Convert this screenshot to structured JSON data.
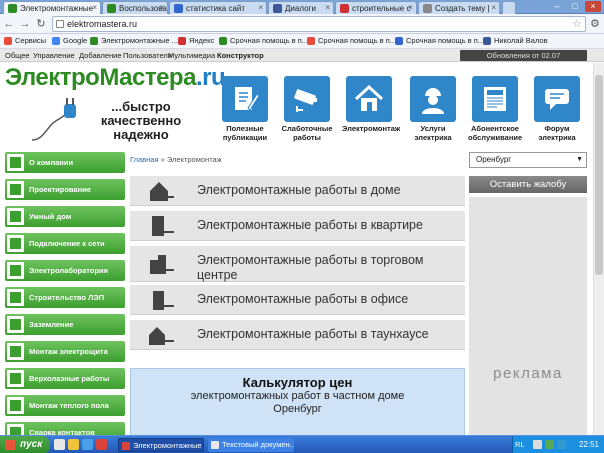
{
  "browser": {
    "tabs": [
      {
        "title": "Электромонтажные",
        "fav": "#2e8b24",
        "active": true
      },
      {
        "title": "Воспользовавшис",
        "fav": "#2e8b24",
        "active": false
      },
      {
        "title": "статистика сайт",
        "fav": "#3366cc",
        "active": false
      },
      {
        "title": "Диалоги",
        "fav": "#3b5998",
        "active": false
      },
      {
        "title": "строительные с",
        "fav": "#d03030",
        "active": false
      },
      {
        "title": "Создать тему |",
        "fav": "#888888",
        "active": false
      }
    ],
    "url": "elektromastera.ru",
    "bookmarks": [
      {
        "label": "Сервисы",
        "color": "#e84a3b"
      },
      {
        "label": "Google",
        "color": "#4285f4"
      },
      {
        "label": "Электромонтажные ...",
        "color": "#2e8b24"
      },
      {
        "label": "Яндекс",
        "color": "#d03030"
      },
      {
        "label": "Срочная помощь в п...",
        "color": "#2e8b24"
      },
      {
        "label": "Срочная помощь в п...",
        "color": "#e84a3b"
      },
      {
        "label": "Срочная помощь в п...",
        "color": "#3366cc"
      },
      {
        "label": "Николай Валов",
        "color": "#3b5998"
      }
    ]
  },
  "admin_menu": {
    "items": [
      "Общее",
      "Управление",
      "Добавление",
      "Пользователи",
      "Мультимедиа",
      "Конструктор"
    ],
    "updates": "Обновления от 02.07"
  },
  "header": {
    "logo_main": "ЭлектроМастера",
    "logo_domain": ".ru",
    "slogan": "...быстро качественно надежно",
    "nav": [
      {
        "label": "Полезные публикации",
        "icon": "document-pencil-icon"
      },
      {
        "label": "Слаботочные работы",
        "icon": "camera-icon"
      },
      {
        "label": "Электромонтаж",
        "icon": "house-icon"
      },
      {
        "label": "Услуги электрика",
        "icon": "worker-icon"
      },
      {
        "label": "Абонентское обслуживание",
        "icon": "newspaper-icon"
      },
      {
        "label": "Форум электрика",
        "icon": "chat-icon"
      }
    ]
  },
  "sidebar": {
    "items": [
      "О компании",
      "Проектирование",
      "Умный дом",
      "Подключение к сети",
      "Электролаборатория",
      "Строительство ЛЭП",
      "Заземление",
      "Монтаж электрощита",
      "Верхолазные работы",
      "Монтаж теплого пола",
      "Сварка контактов"
    ]
  },
  "breadcrumb": {
    "home": "Главная",
    "sep": " » ",
    "current": "Электромонтаж"
  },
  "services": [
    {
      "label": "Электромонтажные работы в доме"
    },
    {
      "label": "Электромонтажные работы в квартире"
    },
    {
      "label": "Электромонтажные работы в торговом центре"
    },
    {
      "label": "Электромонтажные работы в офисе"
    },
    {
      "label": "Электромонтажные работы в таунхаусе"
    }
  ],
  "calculator": {
    "title": "Калькулятор цен",
    "line1": "электромонтажных работ в частном доме",
    "line2": "Оренбург"
  },
  "right": {
    "city": "Оренбург",
    "complain": "Оставить жалобу",
    "ad": "реклама"
  },
  "taskbar": {
    "start": "пуск",
    "windows": [
      {
        "label": "Электромонтажные ...",
        "active": true
      },
      {
        "label": "Текстовый докумен...",
        "active": false
      }
    ],
    "lang": "RL",
    "clock": "22:51"
  },
  "colors": {
    "green": "#3b9f2e",
    "blue": "#2f86c9",
    "logo_green": "#2e8b24"
  }
}
